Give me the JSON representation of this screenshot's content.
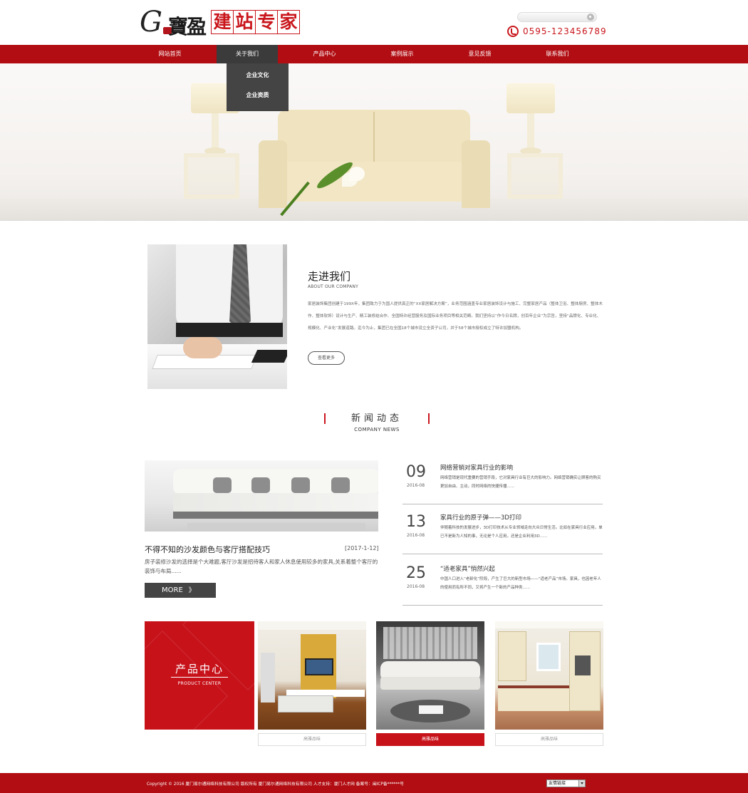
{
  "logo": {
    "letter": "G",
    "calligraphy": "寶盈",
    "title_chars": [
      "建",
      "站",
      "专",
      "家"
    ]
  },
  "header": {
    "phone": "0595-123456789"
  },
  "nav": {
    "items": [
      "网站首页",
      "关于我们",
      "产品中心",
      "案例展示",
      "意见反馈",
      "联系我们"
    ],
    "dropdown": [
      "企业文化",
      "企业资质"
    ]
  },
  "about": {
    "title": "走进我们",
    "subtitle": "ABOUT OUR COMPANY",
    "text": "家居装饰集团创建于199X年，集团致力于为国人提供真正的“XX家居解决方案”，业务范围涵盖专业家居装饰设计与施工、完整家居产品（整体卫浴、整体厨房、整体木作、整体软饰）设计与生产、精工装修结合作、全国特许经营服务及国际业务项目等相关范畴。我们坚持以“作今日名牌，创百年企业”为宗旨，坚持“品牌化、专业化、规模化、产业化”发展道路。迄今为止，集团已在全国18个城市设立全资子公司，并于58个城市授权成立了特许加盟机构。",
    "more": "查看更多"
  },
  "news": {
    "title": "新闻动态",
    "subtitle": "COMPANY NEWS",
    "featured": {
      "title": "不得不知的沙发颜色与客厅搭配技巧",
      "date": "[2017-1-12]",
      "text": "房子装修沙发的选择是个大难题,客厅沙发是招待客人和家人休息使用较多的家具,关系着整个客厅的装饰与布局......",
      "more": "MORE",
      "more_arrows": "》"
    },
    "items": [
      {
        "day": "09",
        "month": "2016-08",
        "title": "网络营销对家具行业的影响",
        "text": "网络营销是现代重要的营销手段，它对家具行业有巨大的影响力。网络营销确实让顾客的购买更加自由、主动，同时网络的快捷传播......"
      },
      {
        "day": "13",
        "month": "2016-08",
        "title": "家具行业的原子弹——3D打印",
        "text": "伴随着科技的发展进步，3D打印技术从专业领域走向大众日常生活。比如在家具行业应用，单已不是新为人知的事，无论是个人应用，还是企业利用3D......"
      },
      {
        "day": "25",
        "month": "2016-08",
        "title": "“适老家具”悄然兴起",
        "text": "中国人口进入“老龄化”阶段，产生了巨大的新型市场——“适老产品”市场。家具，也因老年人的使用而有所不同，又将产生一个新的产品种类......"
      }
    ]
  },
  "products": {
    "title": "产品中心",
    "subtitle": "PRODUCT CENTER",
    "captions": [
      "高雅品味",
      "高雅品味",
      "高雅品味"
    ]
  },
  "footer": {
    "copyright": "Copyright © 2016 厦门易尔通网络科技有限公司 版权所有  厦门易尔通网络科技有限公司 人才支持：厦门人才网 备案号：闽ICP备******号",
    "friend_links": "友情链接"
  },
  "colors": {
    "brand_red": "#b10d12",
    "accent_red": "#c7121a",
    "nav_active": "#3b3b3b"
  }
}
